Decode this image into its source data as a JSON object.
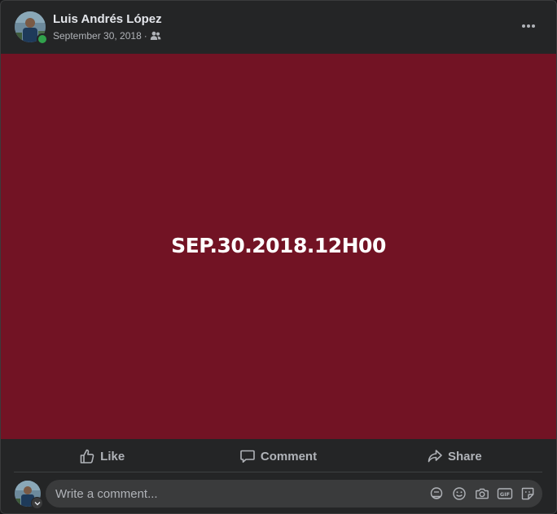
{
  "post": {
    "author": "Luis Andrés López",
    "date": "September 30, 2018",
    "separator": "·",
    "audience_icon": "friends-icon",
    "media_text": "SEP.30.2018.12H00",
    "media_background": "#721324"
  },
  "actions": {
    "like": "Like",
    "comment": "Comment",
    "share": "Share"
  },
  "comment_box": {
    "placeholder": "Write a comment...",
    "icons": [
      "avatar-sticker-icon",
      "emoji-icon",
      "camera-icon",
      "gif-icon",
      "sticker-icon"
    ]
  },
  "colors": {
    "card_bg": "#242526",
    "text_primary": "#e4e6eb",
    "text_secondary": "#b0b3b8",
    "online": "#31a24c"
  }
}
